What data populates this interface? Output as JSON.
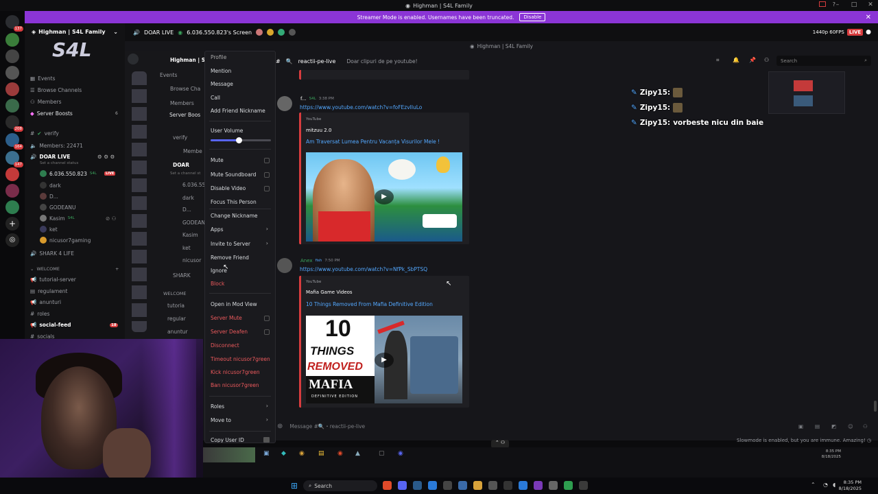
{
  "window": {
    "title": "Highman | S4L Family"
  },
  "banner": {
    "text": "Streamer Mode is enabled. Usernames have been truncated.",
    "button": "Disable"
  },
  "server": {
    "name": "Highman | S4L Family"
  },
  "sidebar": {
    "items": [
      {
        "label": "Events"
      },
      {
        "label": "Browse Channels"
      },
      {
        "label": "Members"
      },
      {
        "label": "Server Boosts",
        "count": "6"
      }
    ],
    "channels": [
      {
        "label": "verify"
      },
      {
        "label": "Members: 22471"
      },
      {
        "label": "DOAR LIVE",
        "sub": "Set a channel status"
      },
      {
        "label": "6.036.550.823",
        "tag": "S4L",
        "live": "LIVE"
      },
      {
        "label": "dark"
      },
      {
        "label": "D..."
      },
      {
        "label": "GODEANU"
      },
      {
        "label": "Kasim",
        "tag": "S4L"
      },
      {
        "label": "ket"
      },
      {
        "label": "nicusor7gaming"
      },
      {
        "label": "SHARK 4 LIFE"
      },
      {
        "label": "WELCOME"
      },
      {
        "label": "tutorial-server"
      },
      {
        "label": "regulament"
      },
      {
        "label": "anunturi"
      },
      {
        "label": "roles"
      },
      {
        "label": "social-feed",
        "count": "18"
      },
      {
        "label": "socials"
      }
    ]
  },
  "rail_badges": [
    "137",
    "208",
    "164",
    "147"
  ],
  "topbar": {
    "channel": "DOAR LIVE",
    "screen": "6.036.550.823's Screen",
    "quality": "1440p 60FPS",
    "live": "LIVE"
  },
  "stream": {
    "window_title": "Highman | S4L Family",
    "channel_name": "reactii-pe-live",
    "topic": "Doar clipuri de pe youtube!",
    "search_placeholder": "Search",
    "preview_list": [
      "Highman | S",
      "Events",
      "Browse Cha",
      "Members",
      "Server Boos",
      "verify",
      "Membe",
      "DOAR",
      "6.036.55",
      "dark",
      "D...",
      "GODEAN",
      "Kasim",
      "ket",
      "nicusor",
      "SHARK",
      "WELCOME",
      "tutoria",
      "regular",
      "anuntur"
    ],
    "preview_sub": "Set a channel st"
  },
  "messages": [
    {
      "author": "f...",
      "tag": "S4L",
      "time": "3:38 PM",
      "link": "https://www.youtube.com/watch?v=foFEzvIluLo",
      "provider": "YouTube",
      "embed_author": "mitzuu 2.0",
      "embed_title": "Am Traversat Lumea Pentru Vacanța Visurilor Mele !"
    },
    {
      "author": "Anex",
      "tag": "fish",
      "time": "7:50 PM",
      "link": "https://www.youtube.com/watch?v=NfPk_SbPTSQ",
      "provider": "YouTube",
      "embed_author": "Mafia Game Videos",
      "embed_title": "10 Things Removed From Mafia Definitive Edition",
      "thumb_text": [
        "10",
        "THINGS",
        "REMOVED",
        "MAFIA",
        "DEFINITIVE EDITION"
      ]
    }
  ],
  "composer": {
    "placeholder": "Message #🔍・reactii-pe-live"
  },
  "context_menu": {
    "items": [
      {
        "label": "Profile"
      },
      {
        "label": "Mention"
      },
      {
        "label": "Message"
      },
      {
        "label": "Call"
      },
      {
        "label": "Add Friend Nickname"
      },
      {
        "label": "User Volume"
      },
      {
        "label": "Mute"
      },
      {
        "label": "Mute Soundboard"
      },
      {
        "label": "Disable Video"
      },
      {
        "label": "Focus This Person"
      },
      {
        "label": "Change Nickname"
      },
      {
        "label": "Apps"
      },
      {
        "label": "Invite to Server"
      },
      {
        "label": "Remove Friend"
      },
      {
        "label": "Ignore"
      },
      {
        "label": "Block"
      },
      {
        "label": "Open in Mod View"
      },
      {
        "label": "Server Mute"
      },
      {
        "label": "Server Deafen"
      },
      {
        "label": "Disconnect"
      },
      {
        "label": "Timeout nicusor7green"
      },
      {
        "label": "Kick nicusor7green"
      },
      {
        "label": "Ban nicusor7green"
      },
      {
        "label": "Roles"
      },
      {
        "label": "Move to"
      },
      {
        "label": "Copy User ID"
      }
    ],
    "volume": 0.47
  },
  "overlay": {
    "lines": [
      {
        "name": "Zipy15:",
        "text": ""
      },
      {
        "name": "Zipy15:",
        "text": ""
      },
      {
        "name": "Zipy15:",
        "text": "vorbeste nicu din baie"
      }
    ]
  },
  "slowmode": "Slowmode is enabled, but you are immune. Amazing!",
  "inner_clock": {
    "time": "8:35 PM",
    "date": "8/18/2025"
  },
  "taskbar": {
    "search": "Search",
    "time": "8:35 PM",
    "date": "8/18/2025"
  },
  "colors": {
    "accent": "#8b35d6",
    "danger": "#d83c3e",
    "link": "#53a8ff"
  }
}
